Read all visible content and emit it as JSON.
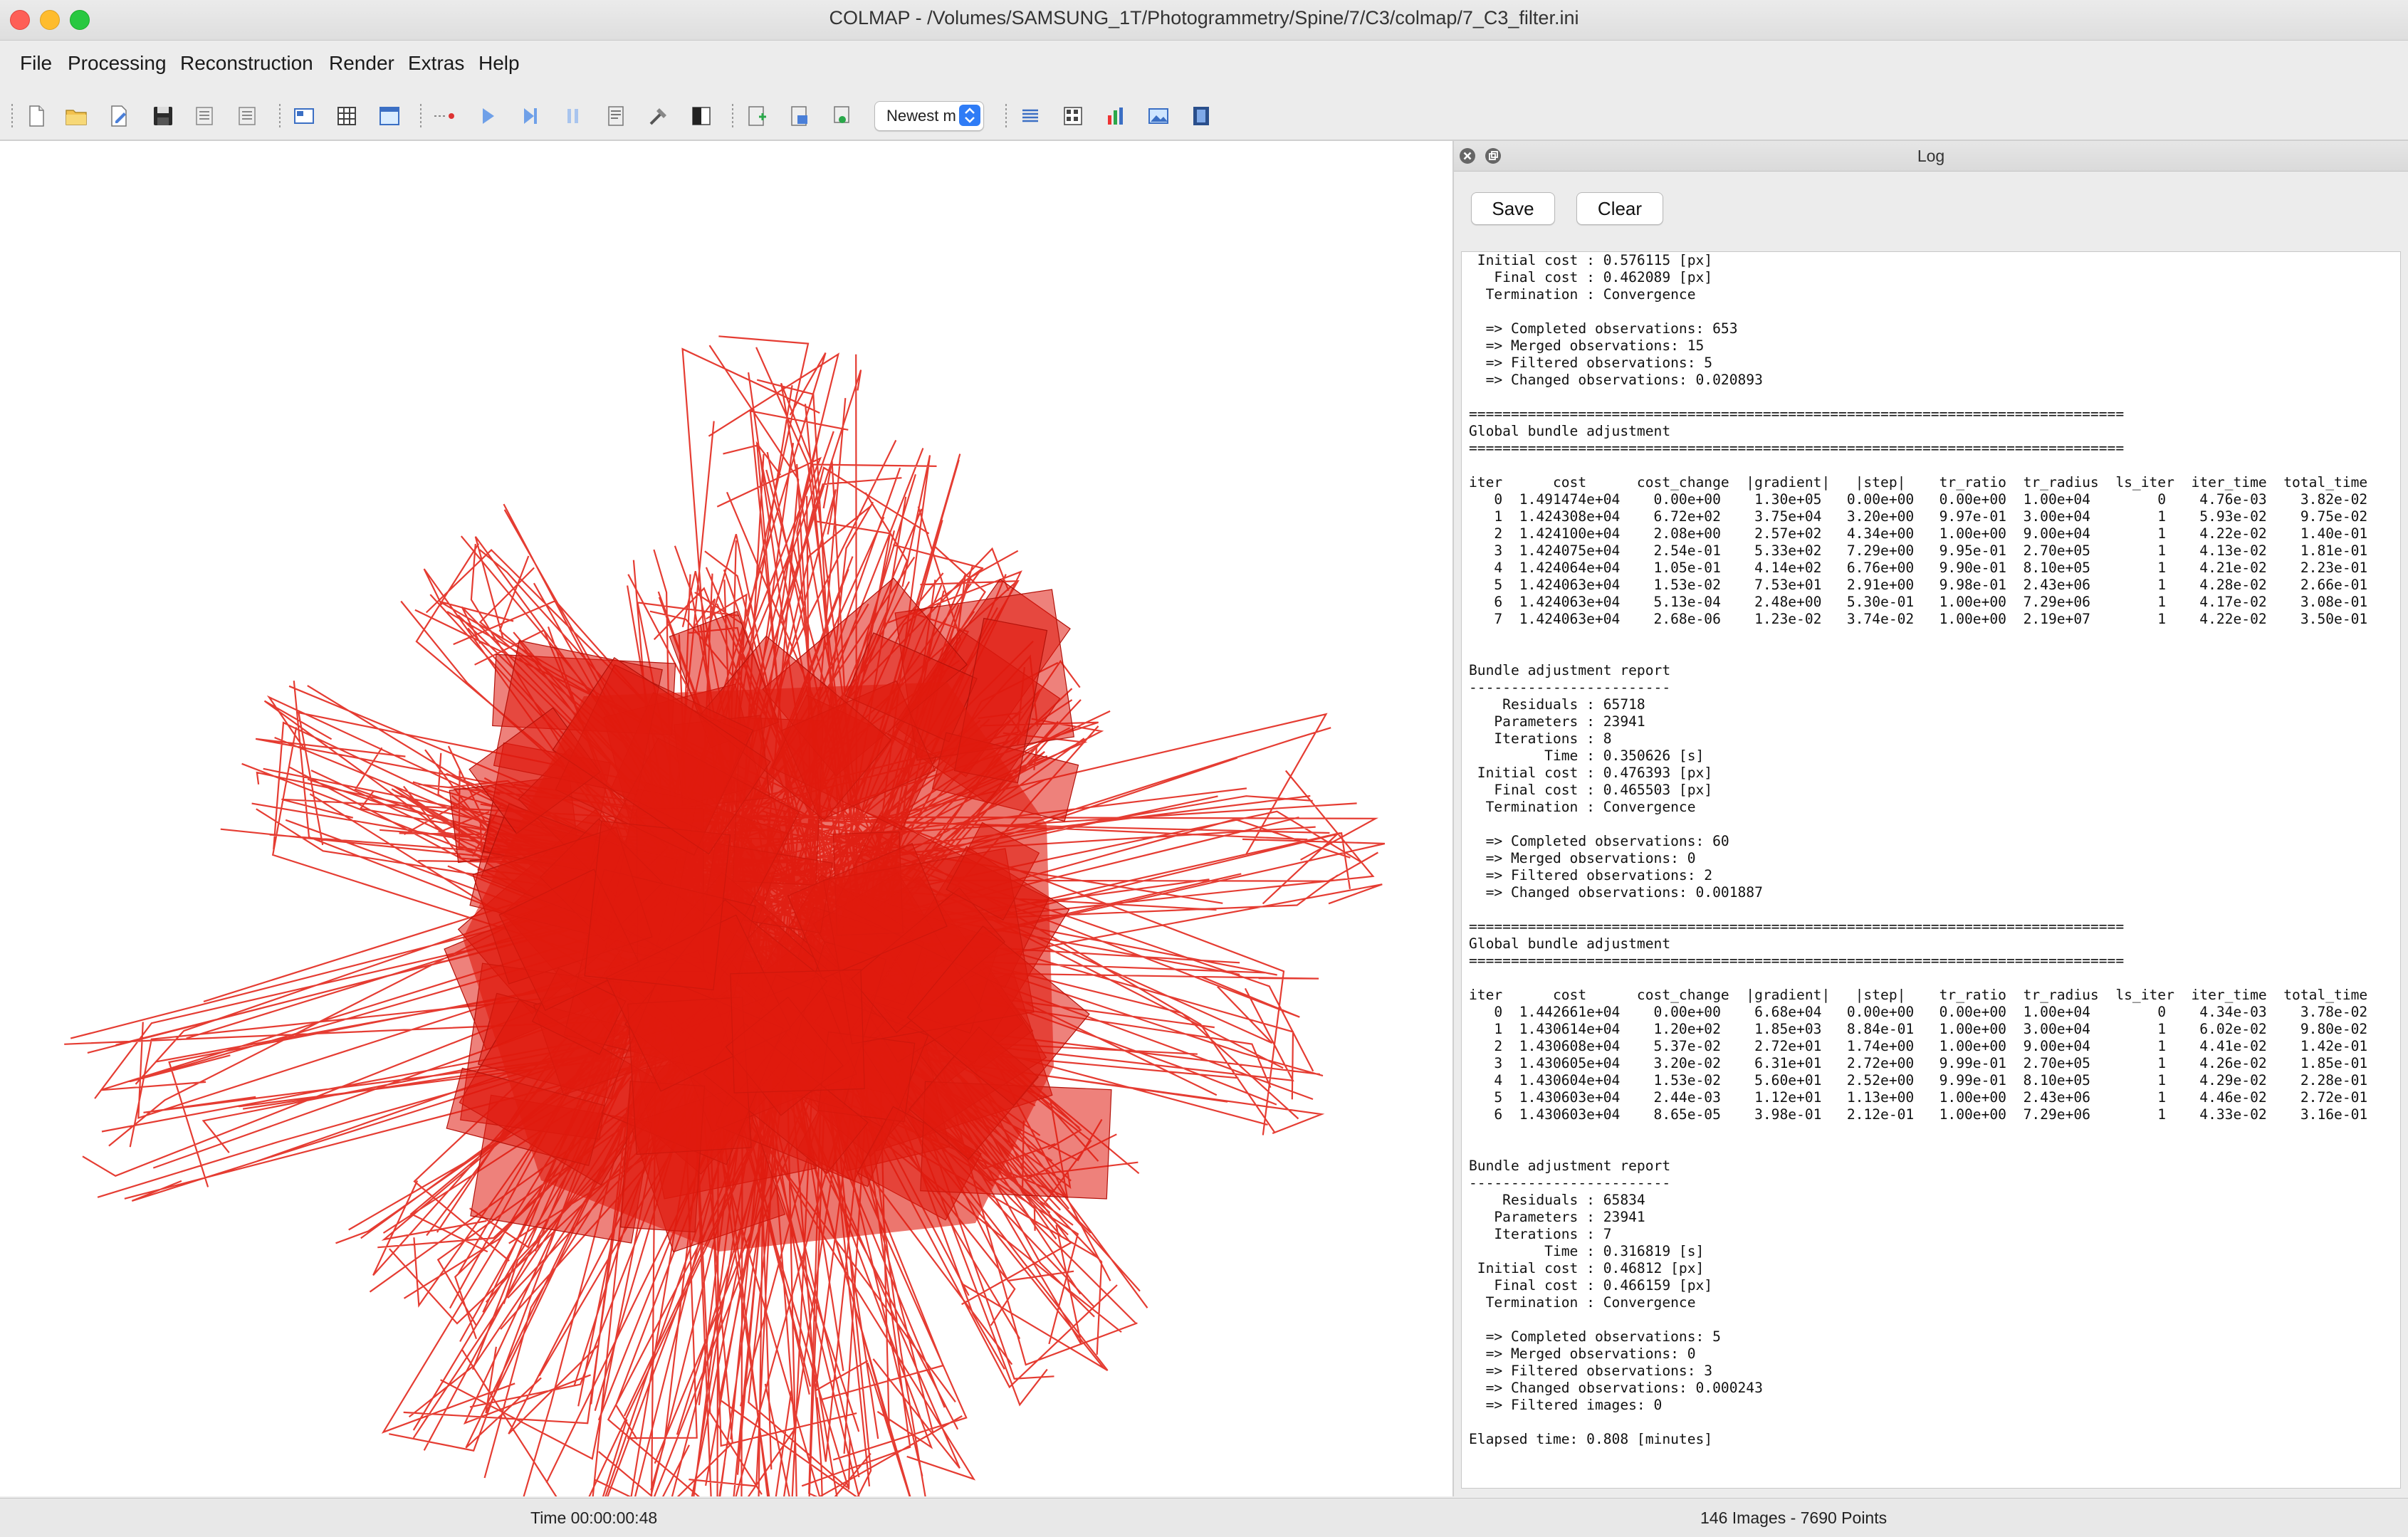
{
  "window": {
    "title": "COLMAP - /Volumes/SAMSUNG_1T/Photogrammetry/Spine/7/C3/colmap/7_C3_filter.ini"
  },
  "menu": [
    "File",
    "Processing",
    "Reconstruction",
    "Render",
    "Extras",
    "Help"
  ],
  "toolbar": {
    "icons": [
      "new-project-icon",
      "open-project-icon",
      "edit-project-icon",
      "save-project-icon",
      "import-model-icon",
      "export-model-icon",
      "database-icon",
      "grid-icon",
      "image-view-icon",
      "feature-matching-icon",
      "play-icon",
      "step-forward-icon",
      "pause-icon",
      "reconstruction-options-icon",
      "tools-icon",
      "bundle-adjustment-icon",
      "add-image-icon",
      "render-options-icon",
      "screenshot-icon",
      "log-icon",
      "match-matrix-icon",
      "chart-icon",
      "image-icon",
      "film-icon"
    ],
    "reconstruction_select": "Newest m"
  },
  "viewer": {
    "color": "#e01a0e"
  },
  "log": {
    "title": "Log",
    "save_label": "Save",
    "clear_label": "Clear",
    "lines": [
      " Initial cost : 0.576115 [px]",
      "   Final cost : 0.462089 [px]",
      "  Termination : Convergence",
      "",
      "  => Completed observations: 653",
      "  => Merged observations: 15",
      "  => Filtered observations: 5",
      "  => Changed observations: 0.020893",
      "",
      "==============================================================================",
      "Global bundle adjustment",
      "==============================================================================",
      "",
      "iter      cost      cost_change  |gradient|   |step|    tr_ratio  tr_radius  ls_iter  iter_time  total_time",
      "   0  1.491474e+04    0.00e+00    1.30e+05   0.00e+00   0.00e+00  1.00e+04        0    4.76e-03    3.82e-02",
      "   1  1.424308e+04    6.72e+02    3.75e+04   3.20e+00   9.97e-01  3.00e+04        1    5.93e-02    9.75e-02",
      "   2  1.424100e+04    2.08e+00    2.57e+02   4.34e+00   1.00e+00  9.00e+04        1    4.22e-02    1.40e-01",
      "   3  1.424075e+04    2.54e-01    5.33e+02   7.29e+00   9.95e-01  2.70e+05        1    4.13e-02    1.81e-01",
      "   4  1.424064e+04    1.05e-01    4.14e+02   6.76e+00   9.90e-01  8.10e+05        1    4.21e-02    2.23e-01",
      "   5  1.424063e+04    1.53e-02    7.53e+01   2.91e+00   9.98e-01  2.43e+06        1    4.28e-02    2.66e-01",
      "   6  1.424063e+04    5.13e-04    2.48e+00   5.30e-01   1.00e+00  7.29e+06        1    4.17e-02    3.08e-01",
      "   7  1.424063e+04    2.68e-06    1.23e-02   3.74e-02   1.00e+00  2.19e+07        1    4.22e-02    3.50e-01",
      "",
      "",
      "Bundle adjustment report",
      "------------------------",
      "    Residuals : 65718",
      "   Parameters : 23941",
      "   Iterations : 8",
      "         Time : 0.350626 [s]",
      " Initial cost : 0.476393 [px]",
      "   Final cost : 0.465503 [px]",
      "  Termination : Convergence",
      "",
      "  => Completed observations: 60",
      "  => Merged observations: 0",
      "  => Filtered observations: 2",
      "  => Changed observations: 0.001887",
      "",
      "==============================================================================",
      "Global bundle adjustment",
      "==============================================================================",
      "",
      "iter      cost      cost_change  |gradient|   |step|    tr_ratio  tr_radius  ls_iter  iter_time  total_time",
      "   0  1.442661e+04    0.00e+00    6.68e+04   0.00e+00   0.00e+00  1.00e+04        0    4.34e-03    3.78e-02",
      "   1  1.430614e+04    1.20e+02    1.85e+03   8.84e-01   1.00e+00  3.00e+04        1    6.02e-02    9.80e-02",
      "   2  1.430608e+04    5.37e-02    2.72e+01   1.74e+00   1.00e+00  9.00e+04        1    4.41e-02    1.42e-01",
      "   3  1.430605e+04    3.20e-02    6.31e+01   2.72e+00   9.99e-01  2.70e+05        1    4.26e-02    1.85e-01",
      "   4  1.430604e+04    1.53e-02    5.60e+01   2.52e+00   9.99e-01  8.10e+05        1    4.29e-02    2.28e-01",
      "   5  1.430603e+04    2.44e-03    1.12e+01   1.13e+00   1.00e+00  2.43e+06        1    4.46e-02    2.72e-01",
      "   6  1.430603e+04    8.65e-05    3.98e-01   2.12e-01   1.00e+00  7.29e+06        1    4.33e-02    3.16e-01",
      "",
      "",
      "Bundle adjustment report",
      "------------------------",
      "    Residuals : 65834",
      "   Parameters : 23941",
      "   Iterations : 7",
      "         Time : 0.316819 [s]",
      " Initial cost : 0.46812 [px]",
      "   Final cost : 0.466159 [px]",
      "  Termination : Convergence",
      "",
      "  => Completed observations: 5",
      "  => Merged observations: 0",
      "  => Filtered observations: 3",
      "  => Changed observations: 0.000243",
      "  => Filtered images: 0",
      "",
      "Elapsed time: 0.808 [minutes]"
    ]
  },
  "status": {
    "time": "Time 00:00:00:48",
    "summary": "146 Images - 7690 Points"
  }
}
